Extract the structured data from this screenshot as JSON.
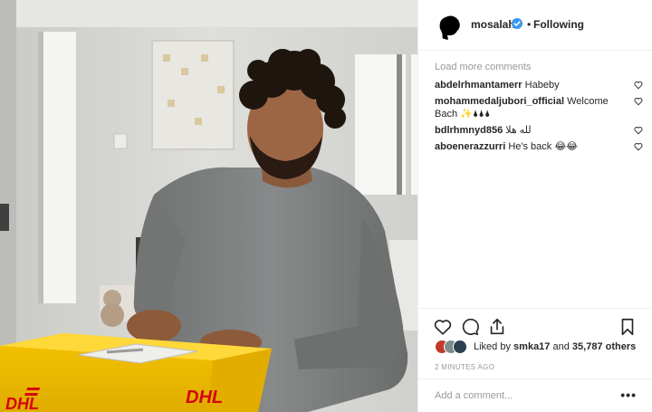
{
  "post": {
    "photo_description": "",
    "box_brand": "DHL"
  },
  "header": {
    "username": "mosalah",
    "separator": "•",
    "follow_status": "Following",
    "verified": true
  },
  "comments": {
    "load_more": "Load more comments",
    "items": [
      {
        "user": "abdelrhmantamerr",
        "text": "Habeby"
      },
      {
        "user": "mohammedaljubori_official",
        "text": "Welcome Bach ✨🌢🌢🌢"
      },
      {
        "user": "bdlrhmnyd856",
        "text": "لله هلا"
      },
      {
        "user": "aboenerazzurri",
        "text": "He's back 😂😂"
      }
    ]
  },
  "actions": {
    "like_icon": "heart-icon",
    "comment_icon": "comment-icon",
    "share_icon": "share-icon",
    "save_icon": "bookmark-icon"
  },
  "likes": {
    "prefix": "Liked by",
    "user": "smka17",
    "connector": "and",
    "others": "35,787 others"
  },
  "timestamp": "2 MINUTES AGO",
  "add_comment": {
    "placeholder": "Add a comment...",
    "more": "•••"
  },
  "colors": {
    "accent": "#3897f0",
    "dhl_yellow": "#ffcc00",
    "dhl_red": "#d40511"
  }
}
